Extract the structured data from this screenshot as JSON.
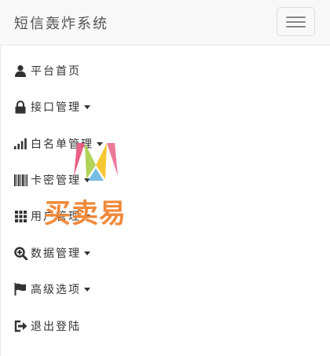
{
  "navbar": {
    "brand": "短信轰炸系统",
    "toggle_icon": "hamburger-icon"
  },
  "menu": {
    "items": [
      {
        "label": "平台首页",
        "icon": "user-icon",
        "has_caret": false
      },
      {
        "label": "接口管理",
        "icon": "lock-icon",
        "has_caret": true
      },
      {
        "label": "白名单管理",
        "icon": "signal-bars-icon",
        "has_caret": true
      },
      {
        "label": "卡密管理",
        "icon": "barcode-icon",
        "has_caret": true
      },
      {
        "label": "用户管理",
        "icon": "grid-icon",
        "has_caret": true
      },
      {
        "label": "数据管理",
        "icon": "zoom-in-icon",
        "has_caret": true
      },
      {
        "label": "高级选项",
        "icon": "flag-icon",
        "has_caret": true
      },
      {
        "label": "退出登陆",
        "icon": "log-out-icon",
        "has_caret": false
      }
    ]
  },
  "watermark": {
    "text": "买卖易",
    "color": "#f0893a"
  }
}
